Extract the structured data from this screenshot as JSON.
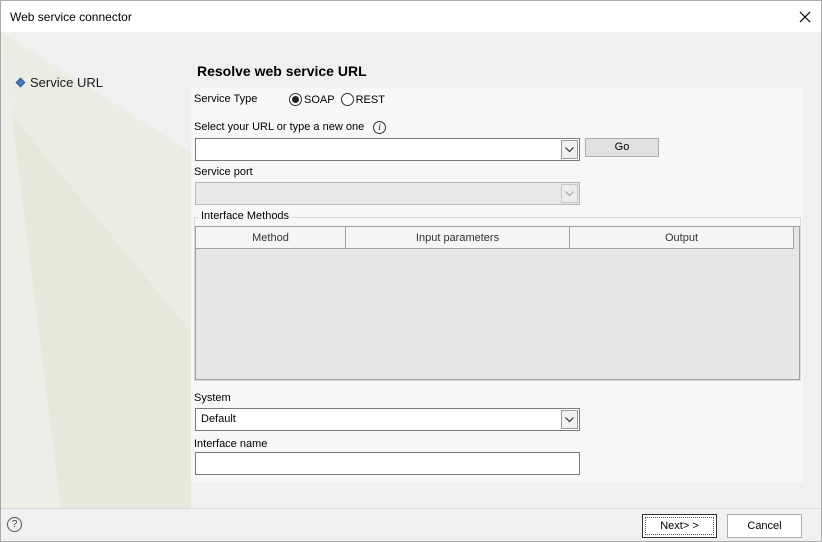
{
  "window": {
    "title": "Web service connector"
  },
  "sidebar": {
    "items": [
      {
        "label": "Service URL"
      }
    ]
  },
  "main": {
    "heading": "Resolve web service URL",
    "service_type": {
      "label": "Service Type",
      "options": [
        {
          "label": "SOAP",
          "selected": true
        },
        {
          "label": "REST",
          "selected": false
        }
      ]
    },
    "url": {
      "label": "Select your URL or type a new one",
      "value": "",
      "go_label": "Go"
    },
    "service_port": {
      "label": "Service port",
      "value": ""
    },
    "interface_methods": {
      "title": "Interface Methods",
      "columns": [
        "Method",
        "Input parameters",
        "Output"
      ],
      "rows": []
    },
    "system": {
      "label": "System",
      "value": "Default"
    },
    "interface_name": {
      "label": "Interface name",
      "value": ""
    }
  },
  "footer": {
    "help_glyph": "?",
    "next_label": "Next> >",
    "cancel_label": "Cancel"
  },
  "colors": {
    "accent": "#4a78b8",
    "panel_bg": "#f7f7f7",
    "window_bg": "#f0f0f0"
  }
}
